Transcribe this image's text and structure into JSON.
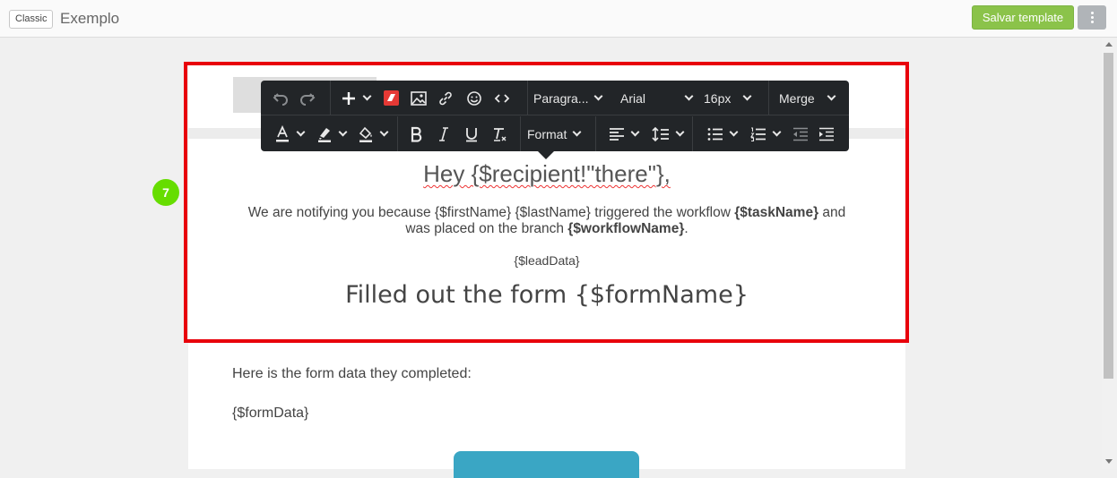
{
  "header": {
    "mode_badge": "Classic",
    "template_name": "Exemplo",
    "save_label": "Salvar template"
  },
  "toolbar": {
    "paragraph_label": "Paragra...",
    "font_label": "Arial",
    "size_label": "16px",
    "merge_label": "Merge",
    "format_label": "Format"
  },
  "step_marker": "7",
  "email": {
    "hero_title": "Hey {$recipient!\"there\"},",
    "notify_prefix": "We are notifying you because {$firstName} {$lastName} triggered the workflow ",
    "task_var": "{$taskName}",
    "notify_mid": " and was placed on the branch ",
    "workflow_var": "{$workflowName}",
    "notify_suffix": ".",
    "lead_data": "{$leadData}",
    "form_heading": "Filled out the form {$formName}",
    "form_data_intro": "Here is the form data they completed:",
    "form_data_var": "{$formData}"
  },
  "colors": {
    "save_button": "#8bc34a",
    "highlight": "#e8000b",
    "step_marker": "#66dd00",
    "toolbar_bg": "#222528",
    "cta_button": "#3aa6c4"
  },
  "icons": [
    "undo-icon",
    "redo-icon",
    "insert-plus-icon",
    "brand-logo-icon",
    "image-icon",
    "link-icon",
    "emoji-icon",
    "code-icon",
    "text-color-icon",
    "highlight-color-icon",
    "fill-color-icon",
    "bold-icon",
    "italic-icon",
    "underline-icon",
    "clear-format-icon",
    "align-left-icon",
    "line-height-icon",
    "bullet-list-icon",
    "numbered-list-icon",
    "outdent-icon",
    "indent-icon"
  ]
}
